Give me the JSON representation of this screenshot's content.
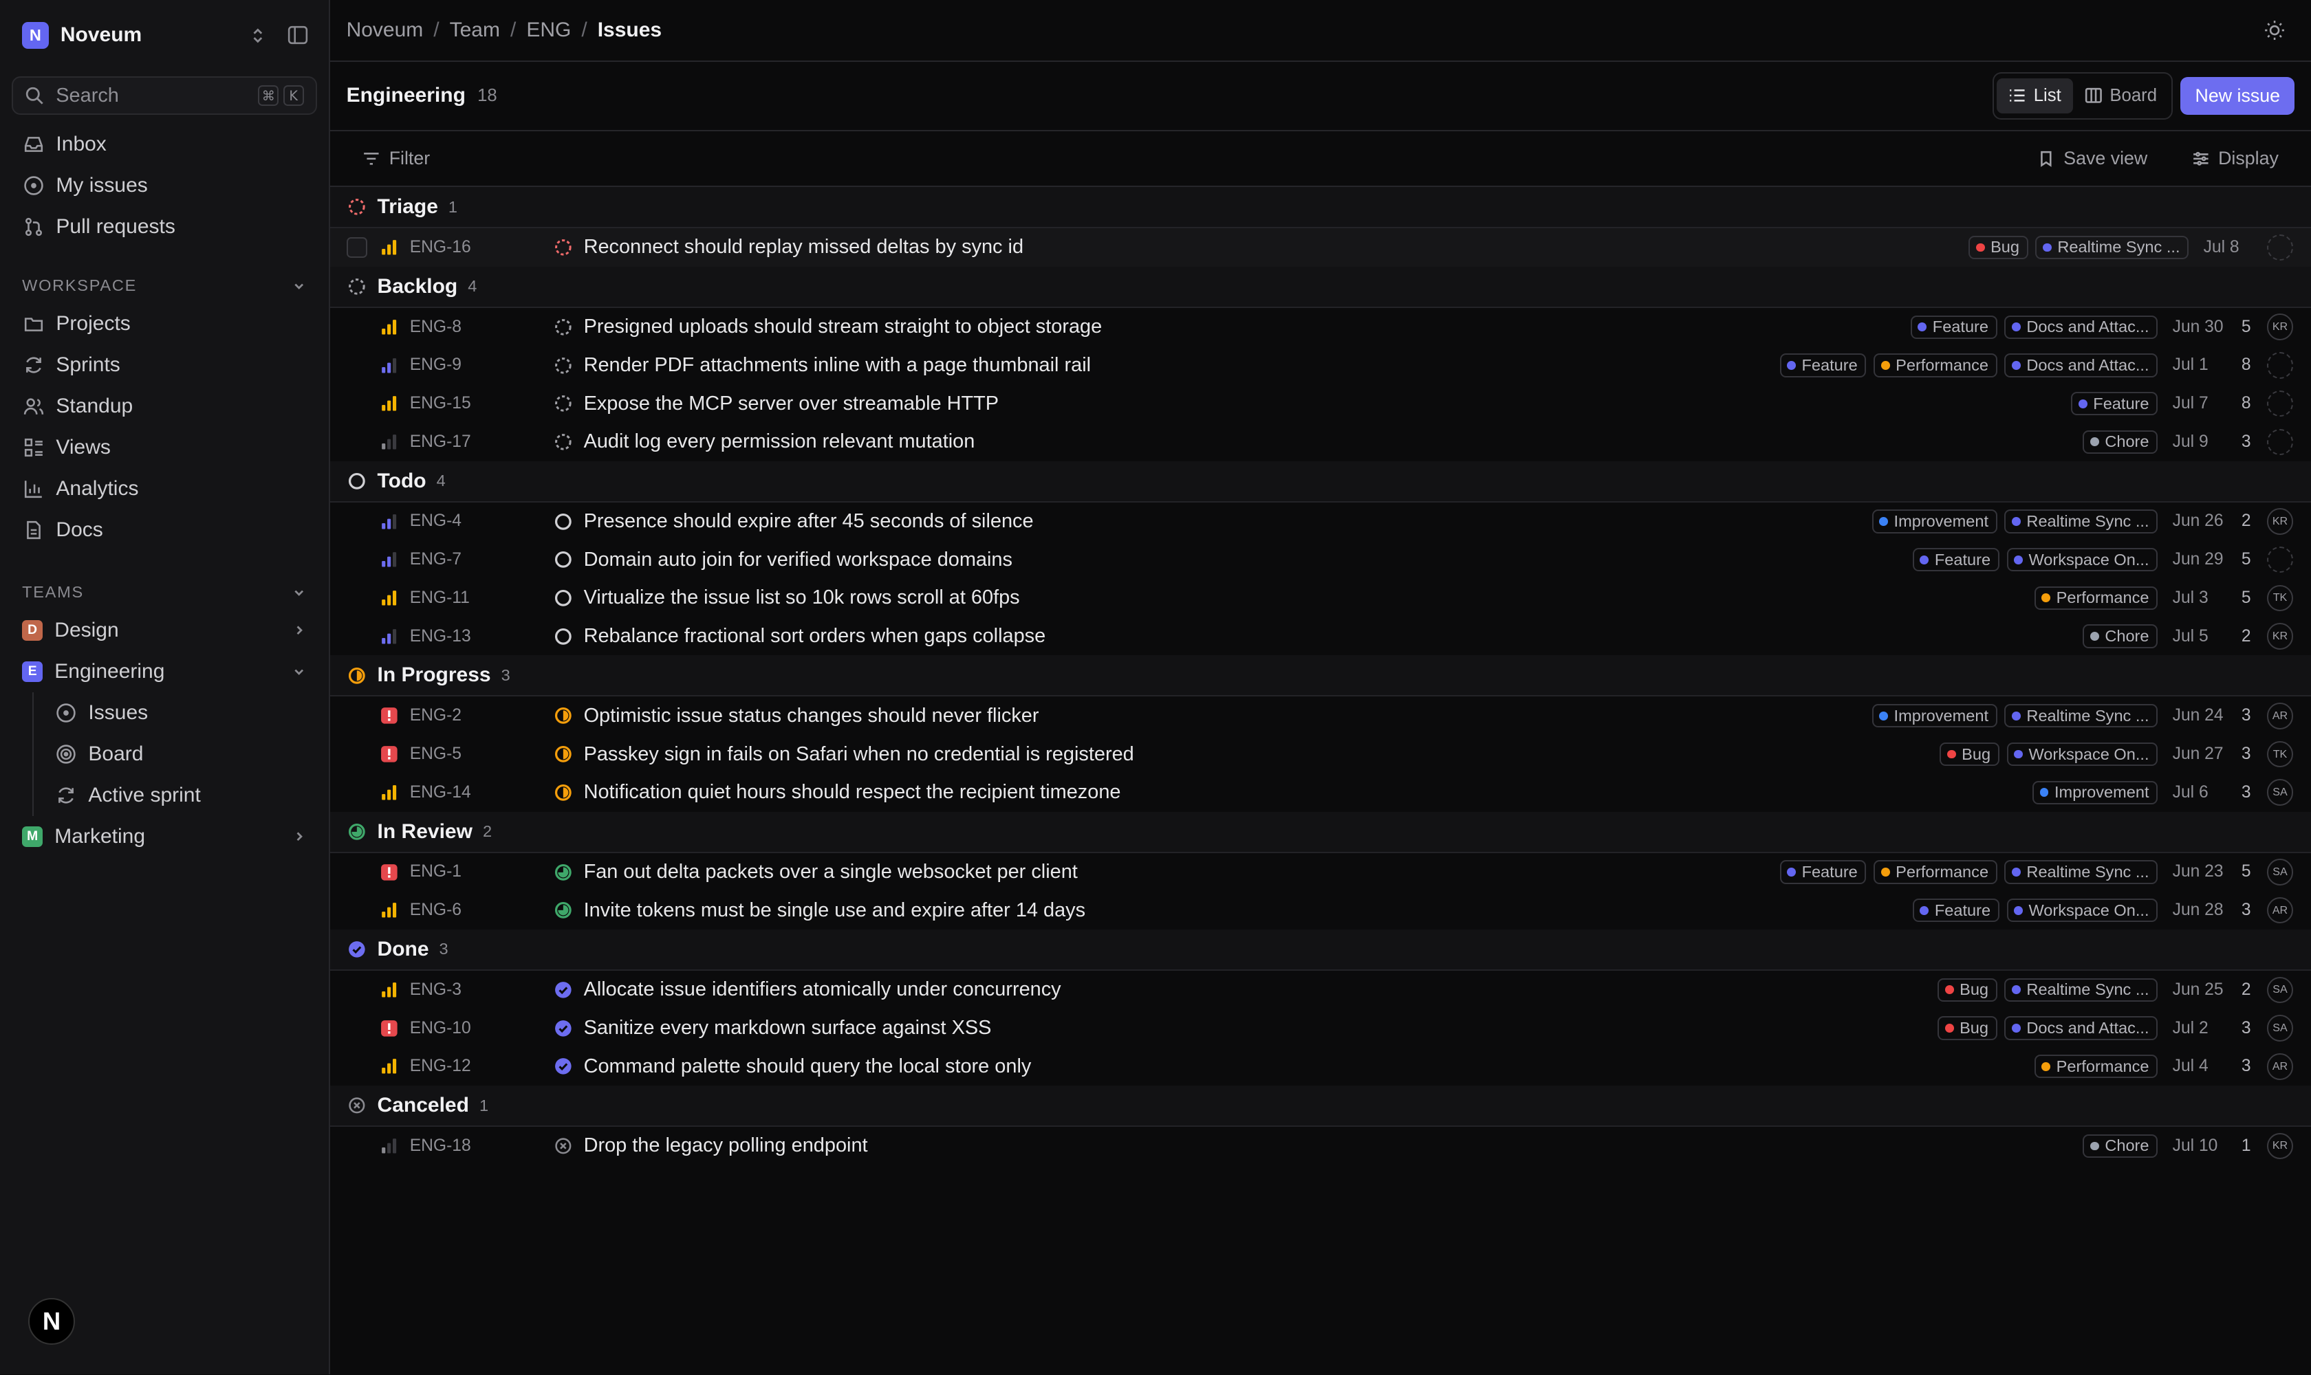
{
  "workspace": {
    "initial": "N",
    "name": "Noveum"
  },
  "search": {
    "placeholder": "Search",
    "kbd1": "⌘",
    "kbd2": "K"
  },
  "nav": [
    {
      "label": "Inbox",
      "icon": "inbox-icon"
    },
    {
      "label": "My issues",
      "icon": "user-circle-icon"
    },
    {
      "label": "Pull requests",
      "icon": "git-pull-request-icon"
    }
  ],
  "workspace_section": {
    "label": "WORKSPACE",
    "items": [
      {
        "label": "Projects",
        "icon": "folder-icon"
      },
      {
        "label": "Sprints",
        "icon": "refresh-icon"
      },
      {
        "label": "Standup",
        "icon": "users-icon"
      },
      {
        "label": "Views",
        "icon": "views-icon"
      },
      {
        "label": "Analytics",
        "icon": "chart-icon"
      },
      {
        "label": "Docs",
        "icon": "doc-icon"
      }
    ]
  },
  "teams_section": {
    "label": "TEAMS",
    "teams": [
      {
        "initial": "D",
        "name": "Design",
        "color": "#c0674a"
      },
      {
        "initial": "E",
        "name": "Engineering",
        "color": "#6366f1",
        "sub": [
          "Issues",
          "Board",
          "Active sprint"
        ]
      },
      {
        "initial": "M",
        "name": "Marketing",
        "color": "#3fa86a"
      }
    ]
  },
  "user": {
    "initial": "N"
  },
  "breadcrumb": [
    "Noveum",
    "Team",
    "ENG",
    "Issues"
  ],
  "header": {
    "title": "Engineering",
    "count": "18",
    "list": "List",
    "board": "Board",
    "new_issue": "New issue"
  },
  "filterbar": {
    "filter": "Filter",
    "save_view": "Save view",
    "display": "Display"
  },
  "colors": {
    "accent": "#6d6df0",
    "bug": "#ef4444",
    "feature": "#6366f1",
    "improvement": "#3b82f6",
    "performance": "#f59e0b",
    "chore": "#9ca3af",
    "triage": "#ef6b6b",
    "progress": "#f59e0b",
    "review": "#3fa86a",
    "done": "#6d6df0"
  },
  "label_colors": {
    "Bug": "#ef4444",
    "Feature": "#6366f1",
    "Improvement": "#3b82f6",
    "Performance": "#f59e0b",
    "Chore": "#9ca3af",
    "Realtime Sync ...": "#6366f1",
    "Docs and Attac...": "#6366f1",
    "Workspace On...": "#6366f1"
  },
  "groups": [
    {
      "name": "Triage",
      "count": "1",
      "status": "triage",
      "issues": [
        {
          "id": "ENG-16",
          "prio": "high",
          "title": "Reconnect should replay missed deltas by sync id",
          "labels": [
            "Bug",
            "Realtime Sync ..."
          ],
          "due": "Jul 8",
          "est": "",
          "assignee": "",
          "checkbox": true
        }
      ]
    },
    {
      "name": "Backlog",
      "count": "4",
      "status": "backlog",
      "issues": [
        {
          "id": "ENG-8",
          "prio": "high",
          "title": "Presigned uploads should stream straight to object storage",
          "labels": [
            "Feature",
            "Docs and Attac..."
          ],
          "due": "Jun 30",
          "est": "5",
          "assignee": "KR"
        },
        {
          "id": "ENG-9",
          "prio": "medium",
          "title": "Render PDF attachments inline with a page thumbnail rail",
          "labels": [
            "Feature",
            "Performance",
            "Docs and Attac..."
          ],
          "due": "Jul 1",
          "est": "8",
          "assignee": ""
        },
        {
          "id": "ENG-15",
          "prio": "high",
          "title": "Expose the MCP server over streamable HTTP",
          "labels": [
            "Feature"
          ],
          "due": "Jul 7",
          "est": "8",
          "assignee": ""
        },
        {
          "id": "ENG-17",
          "prio": "low",
          "title": "Audit log every permission relevant mutation",
          "labels": [
            "Chore"
          ],
          "due": "Jul 9",
          "est": "3",
          "assignee": ""
        }
      ]
    },
    {
      "name": "Todo",
      "count": "4",
      "status": "todo",
      "issues": [
        {
          "id": "ENG-4",
          "prio": "medium",
          "title": "Presence should expire after 45 seconds of silence",
          "labels": [
            "Improvement",
            "Realtime Sync ..."
          ],
          "due": "Jun 26",
          "est": "2",
          "assignee": "KR"
        },
        {
          "id": "ENG-7",
          "prio": "medium",
          "title": "Domain auto join for verified workspace domains",
          "labels": [
            "Feature",
            "Workspace On..."
          ],
          "due": "Jun 29",
          "est": "5",
          "assignee": ""
        },
        {
          "id": "ENG-11",
          "prio": "high",
          "title": "Virtualize the issue list so 10k rows scroll at 60fps",
          "labels": [
            "Performance"
          ],
          "due": "Jul 3",
          "est": "5",
          "assignee": "TK"
        },
        {
          "id": "ENG-13",
          "prio": "medium",
          "title": "Rebalance fractional sort orders when gaps collapse",
          "labels": [
            "Chore"
          ],
          "due": "Jul 5",
          "est": "2",
          "assignee": "KR"
        }
      ]
    },
    {
      "name": "In Progress",
      "count": "3",
      "status": "progress",
      "issues": [
        {
          "id": "ENG-2",
          "prio": "urgent",
          "title": "Optimistic issue status changes should never flicker",
          "labels": [
            "Improvement",
            "Realtime Sync ..."
          ],
          "due": "Jun 24",
          "est": "3",
          "assignee": "AR"
        },
        {
          "id": "ENG-5",
          "prio": "urgent",
          "title": "Passkey sign in fails on Safari when no credential is registered",
          "labels": [
            "Bug",
            "Workspace On..."
          ],
          "due": "Jun 27",
          "est": "3",
          "assignee": "TK"
        },
        {
          "id": "ENG-14",
          "prio": "high",
          "title": "Notification quiet hours should respect the recipient timezone",
          "labels": [
            "Improvement"
          ],
          "due": "Jul 6",
          "est": "3",
          "assignee": "SA"
        }
      ]
    },
    {
      "name": "In Review",
      "count": "2",
      "status": "review",
      "issues": [
        {
          "id": "ENG-1",
          "prio": "urgent",
          "title": "Fan out delta packets over a single websocket per client",
          "labels": [
            "Feature",
            "Performance",
            "Realtime Sync ..."
          ],
          "due": "Jun 23",
          "est": "5",
          "assignee": "SA"
        },
        {
          "id": "ENG-6",
          "prio": "high",
          "title": "Invite tokens must be single use and expire after 14 days",
          "labels": [
            "Feature",
            "Workspace On..."
          ],
          "due": "Jun 28",
          "est": "3",
          "assignee": "AR"
        }
      ]
    },
    {
      "name": "Done",
      "count": "3",
      "status": "done",
      "issues": [
        {
          "id": "ENG-3",
          "prio": "high",
          "title": "Allocate issue identifiers atomically under concurrency",
          "labels": [
            "Bug",
            "Realtime Sync ..."
          ],
          "due": "Jun 25",
          "est": "2",
          "assignee": "SA"
        },
        {
          "id": "ENG-10",
          "prio": "urgent",
          "title": "Sanitize every markdown surface against XSS",
          "labels": [
            "Bug",
            "Docs and Attac..."
          ],
          "due": "Jul 2",
          "est": "3",
          "assignee": "SA"
        },
        {
          "id": "ENG-12",
          "prio": "high",
          "title": "Command palette should query the local store only",
          "labels": [
            "Performance"
          ],
          "due": "Jul 4",
          "est": "3",
          "assignee": "AR"
        }
      ]
    },
    {
      "name": "Canceled",
      "count": "1",
      "status": "canceled",
      "issues": [
        {
          "id": "ENG-18",
          "prio": "low",
          "title": "Drop the legacy polling endpoint",
          "labels": [
            "Chore"
          ],
          "due": "Jul 10",
          "est": "1",
          "assignee": "KR"
        }
      ]
    }
  ]
}
